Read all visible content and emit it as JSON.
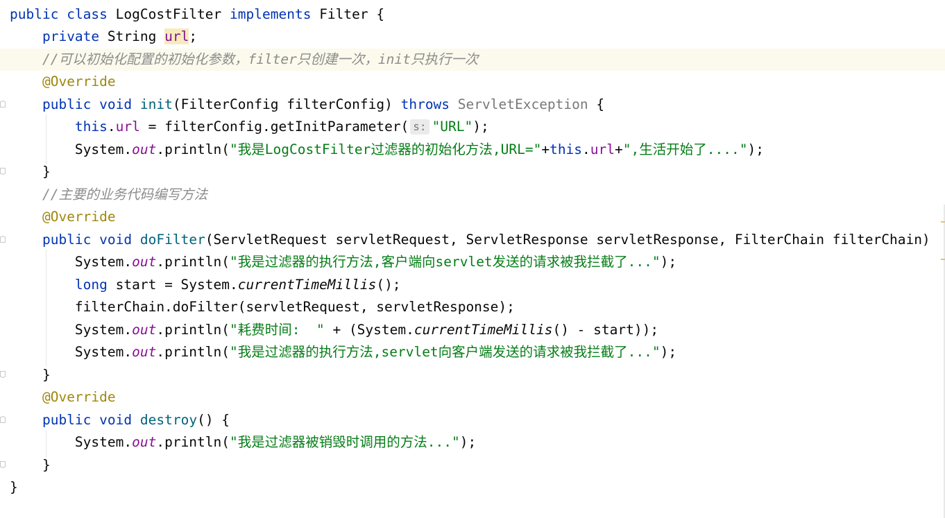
{
  "editor": {
    "lines": [
      {
        "kw1": "public",
        "kw2": "class",
        "name": "LogCostFilter",
        "kw3": "implements",
        "iface": "Filter",
        "brace": "{"
      },
      {
        "kw": "private",
        "type": "String",
        "field": "url",
        "semi": ";"
      },
      {
        "comment": "//可以初始化配置的初始化参数，filter只创建一次，init只执行一次"
      },
      {
        "annotation": "@Override"
      },
      {
        "kw1": "public",
        "kw2": "void",
        "method": "init",
        "params": "(FilterConfig filterConfig) ",
        "throws": "throws",
        "exc": "ServletException",
        "brace": " {"
      },
      {
        "this": "this",
        "dot": ".",
        "field": "url",
        "rest": " = filterConfig.getInitParameter(",
        "hint": "s:",
        "str": "\"URL\"",
        "end": ");"
      },
      {
        "sys": "System.",
        "out": "out",
        "call": ".println(",
        "str": "\"我是LogCostFilter过滤器的初始化方法,URL=\"",
        "plus1": "+",
        "this": "this",
        "dot": ".",
        "field": "url",
        "plus2": "+",
        "str2": "\",生活开始了....\"",
        "end": ");"
      },
      {
        "text": "}"
      },
      {
        "comment": "//主要的业务代码编写方法"
      },
      {
        "annotation": "@Override"
      },
      {
        "kw1": "public",
        "kw2": "void",
        "method": "doFilter",
        "params": "(ServletRequest servletRequest, ServletResponse servletResponse, FilterChain filterChain)"
      },
      {
        "sys": "System.",
        "out": "out",
        "call": ".println(",
        "str": "\"我是过滤器的执行方法,客户端向servlet发送的请求被我拦截了...\"",
        "end": ");"
      },
      {
        "kw": "long",
        "rest": " start = System.",
        "static": "currentTimeMillis",
        "end": "();"
      },
      {
        "text": "filterChain.doFilter(servletRequest, servletResponse);"
      },
      {
        "sys": "System.",
        "out": "out",
        "call": ".println(",
        "str": "\"耗费时间:  \"",
        "mid": " + (System.",
        "static": "currentTimeMillis",
        "end": "() - start));"
      },
      {
        "sys": "System.",
        "out": "out",
        "call": ".println(",
        "str": "\"我是过滤器的执行方法,servlet向客户端发送的请求被我拦截了...\"",
        "end": ");"
      },
      {
        "text": "}"
      },
      {
        "annotation": "@Override"
      },
      {
        "kw1": "public",
        "kw2": "void",
        "method": "destroy",
        "rest": "() {"
      },
      {
        "sys": "System.",
        "out": "out",
        "call": ".println(",
        "str": "\"我是过滤器被销毁时调用的方法...\"",
        "end": ");"
      },
      {
        "text": "}"
      },
      {
        "text": "}"
      }
    ]
  },
  "colors": {
    "keyword": "#0033b3",
    "field": "#871094",
    "annotation": "#9e880d",
    "string": "#067d17",
    "comment": "#8c8c8c",
    "method": "#00627a",
    "current_line": "#fcfaed"
  }
}
